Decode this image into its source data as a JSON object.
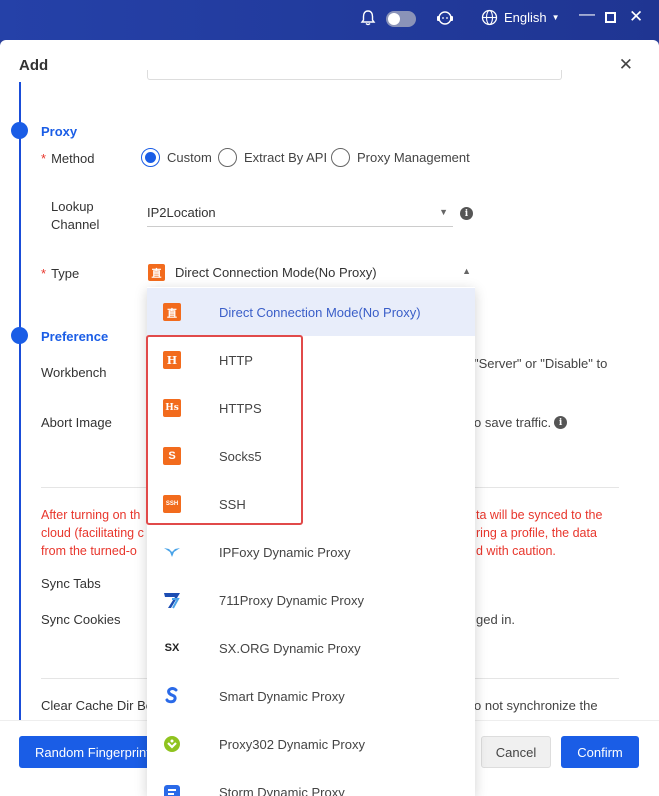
{
  "topbar": {
    "language": "English"
  },
  "modal": {
    "title": "Add"
  },
  "proxy": {
    "section_title": "Proxy",
    "method_label": "Method",
    "method_options": [
      "Custom",
      "Extract By API",
      "Proxy Management"
    ],
    "method_selected": "Custom",
    "lookup_label_1": "Lookup",
    "lookup_label_2": "Channel",
    "lookup_value": "IP2Location",
    "type_label": "Type",
    "type_value": "Direct Connection Mode(No Proxy)"
  },
  "preference": {
    "section_title": "Preference",
    "workbench_label": "Workbench",
    "workbench_hint": "Server\" or \"Disable\" to",
    "abort_image_label": "Abort Image",
    "abort_image_hint": "o save traffic.",
    "warning_line1_a": "After turning on th",
    "warning_line1_b": "ta will be synced to the",
    "warning_line2_a": "cloud (facilitating c",
    "warning_line2_b": "ring a profile, the data",
    "warning_line3_a": "from the turned-o",
    "warning_line3_b": "d with caution.",
    "sync_tabs_label": "Sync Tabs",
    "sync_cookies_label": "Sync Cookies",
    "sync_cookies_hint": "ged in.",
    "clear_cache_label": "Clear Cache Dir Be",
    "clear_cache_hint": "o not synchronize the"
  },
  "footer": {
    "random_fingerprint": "Random Fingerprint",
    "cancel": "Cancel",
    "confirm": "Confirm"
  },
  "dropdown": {
    "options": [
      {
        "label": "Direct Connection Mode(No Proxy)",
        "icon": "直",
        "color": "#f26b1d"
      },
      {
        "label": "HTTP",
        "icon": "H",
        "color": "#f26b1d"
      },
      {
        "label": "HTTPS",
        "icon": "Hs",
        "color": "#f26b1d"
      },
      {
        "label": "Socks5",
        "icon": "S",
        "color": "#f26b1d"
      },
      {
        "label": "SSH",
        "icon": "SSH",
        "color": "#f26b1d"
      },
      {
        "label": "IPFoxy Dynamic Proxy",
        "icon": "ipfoxy-icon",
        "color": "#4aa3e8"
      },
      {
        "label": "711Proxy Dynamic Proxy",
        "icon": "711proxy-icon",
        "color": "#1c4db3"
      },
      {
        "label": "SX.ORG Dynamic Proxy",
        "icon": "SX",
        "color": "#222222"
      },
      {
        "label": "Smart Dynamic Proxy",
        "icon": "smartproxy-icon",
        "color": "#2a6ae8"
      },
      {
        "label": "Proxy302 Dynamic Proxy",
        "icon": "proxy302-icon",
        "color": "#8fc31f"
      },
      {
        "label": "Storm Dynamic Proxy",
        "icon": "storm-icon",
        "color": "#2a6ae8"
      }
    ],
    "selected_index": 0
  }
}
